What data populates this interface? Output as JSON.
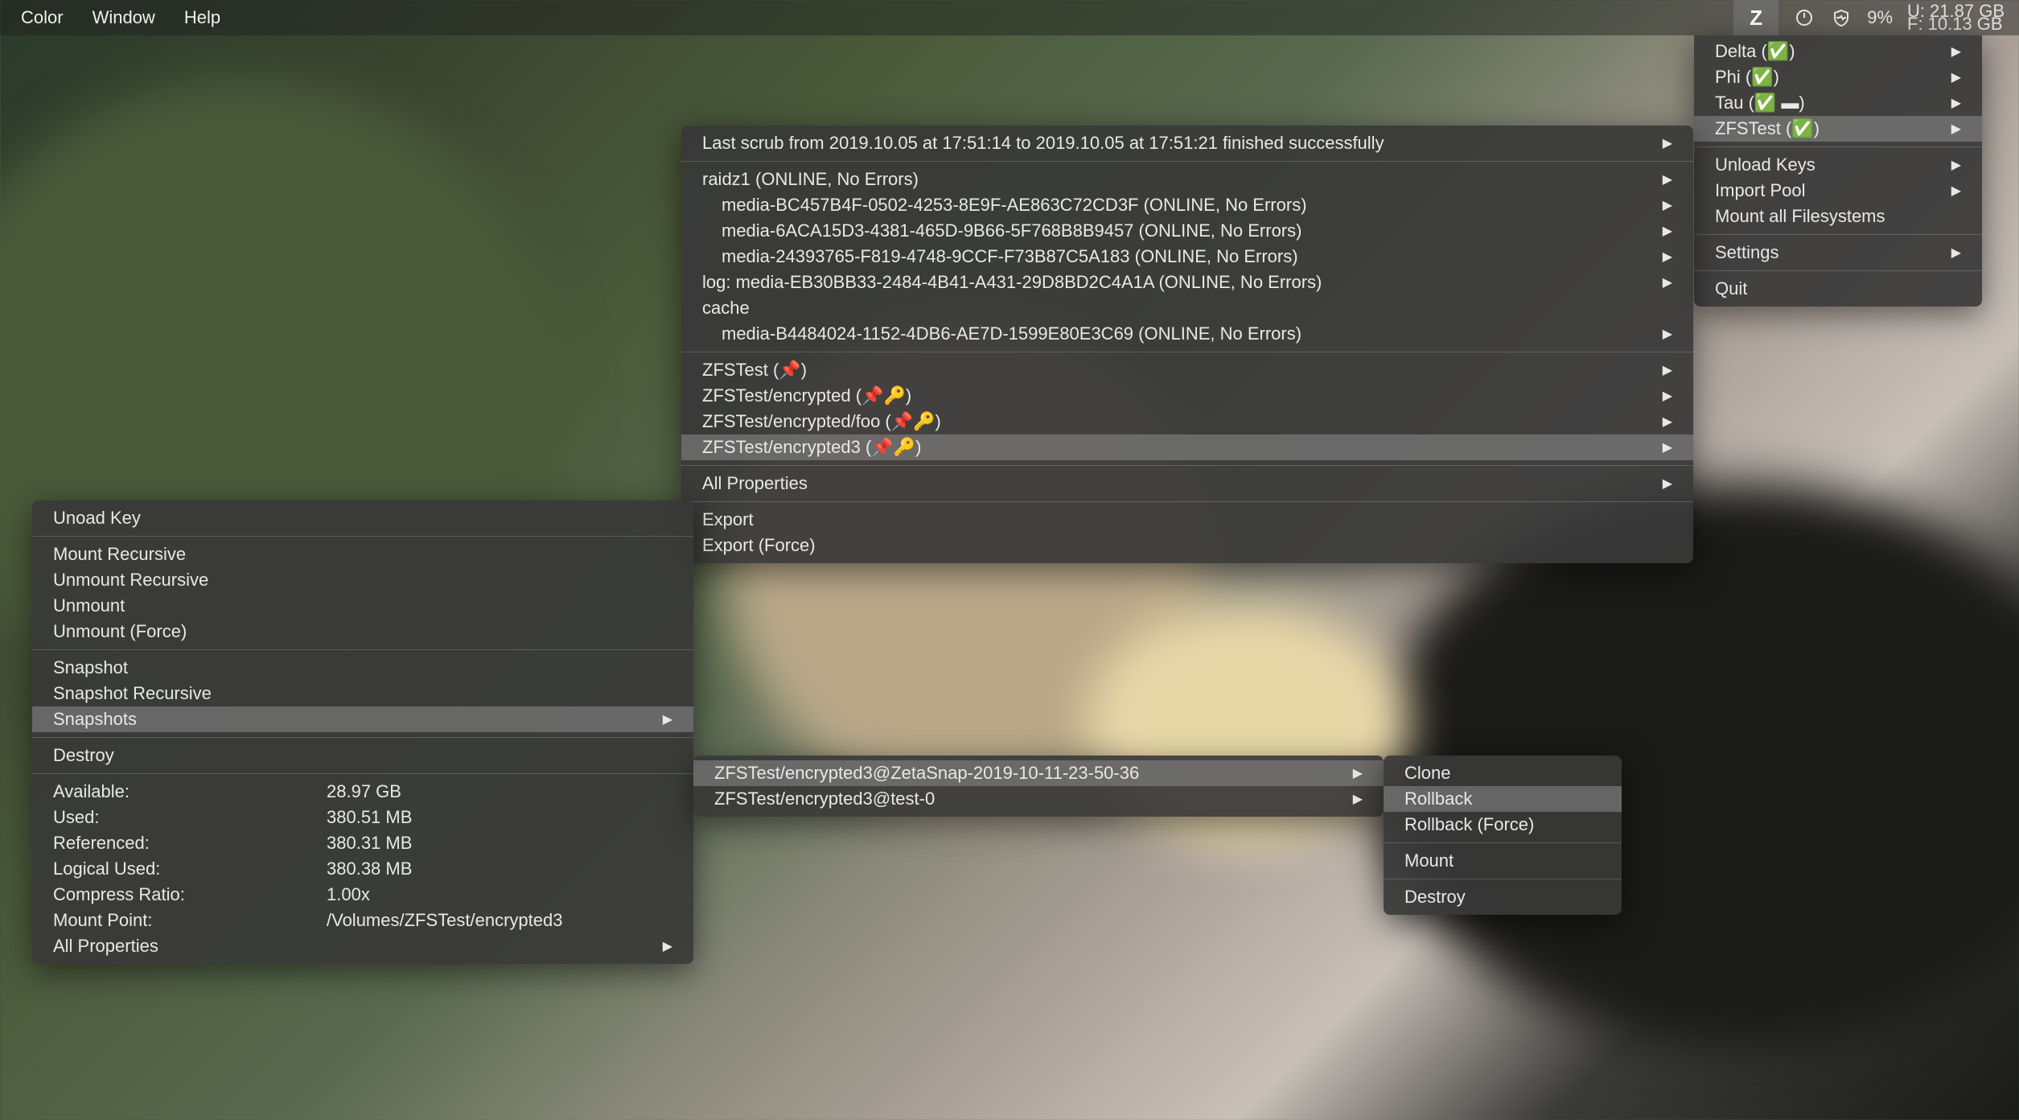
{
  "menubar": {
    "items": [
      "Color",
      "Window",
      "Help"
    ],
    "battery": "9%",
    "disk_used_label": "U:",
    "disk_used": "21.87 GB",
    "disk_free_label": "F:",
    "disk_free": "10.13 GB"
  },
  "pools": {
    "items": [
      {
        "label": "Delta (✅)"
      },
      {
        "label": "Phi (✅)"
      },
      {
        "label": "Tau (✅ ▬)"
      },
      {
        "label": "ZFSTest (✅)"
      }
    ],
    "unload_keys": "Unload Keys",
    "import_pool": "Import Pool",
    "mount_all": "Mount all Filesystems",
    "settings": "Settings",
    "quit": "Quit"
  },
  "pool_detail": {
    "scrub": "Last scrub from 2019.10.05 at 17:51:14 to 2019.10.05 at 17:51:21 finished successfully",
    "vdevs": [
      {
        "text": "raidz1 (ONLINE, No Errors)",
        "indent": 0
      },
      {
        "text": "media-BC457B4F-0502-4253-8E9F-AE863C72CD3F (ONLINE, No Errors)",
        "indent": 1
      },
      {
        "text": "media-6ACA15D3-4381-465D-9B66-5F768B8B9457 (ONLINE, No Errors)",
        "indent": 1
      },
      {
        "text": "media-24393765-F819-4748-9CCF-F73B87C5A183 (ONLINE, No Errors)",
        "indent": 1
      },
      {
        "text": "log: media-EB30BB33-2484-4B41-A431-29D8BD2C4A1A (ONLINE, No Errors)",
        "indent": 0
      },
      {
        "text": "cache",
        "indent": 0
      },
      {
        "text": "media-B4484024-1152-4DB6-AE7D-1599E80E3C69 (ONLINE, No Errors)",
        "indent": 1
      }
    ],
    "datasets": [
      {
        "label": "ZFSTest (📌)"
      },
      {
        "label": "ZFSTest/encrypted (📌🔑)"
      },
      {
        "label": "ZFSTest/encrypted/foo (📌🔑)"
      },
      {
        "label": "ZFSTest/encrypted3 (📌🔑)"
      }
    ],
    "all_properties": "All Properties",
    "export": "Export",
    "export_force": "Export (Force)"
  },
  "dataset_menu": {
    "unload_key": "Unoad Key",
    "mount_recursive": "Mount Recursive",
    "unmount_recursive": "Unmount Recursive",
    "unmount": "Unmount",
    "unmount_force": "Unmount (Force)",
    "snapshot": "Snapshot",
    "snapshot_recursive": "Snapshot Recursive",
    "snapshots": "Snapshots",
    "destroy": "Destroy",
    "props": [
      {
        "label": "Available:",
        "value": "28.97 GB"
      },
      {
        "label": "Used:",
        "value": "380.51 MB"
      },
      {
        "label": "Referenced:",
        "value": "380.31 MB"
      },
      {
        "label": "Logical Used:",
        "value": "380.38 MB"
      },
      {
        "label": "Compress Ratio:",
        "value": "1.00x"
      },
      {
        "label": "Mount Point:",
        "value": "/Volumes/ZFSTest/encrypted3"
      }
    ],
    "all_properties": "All Properties"
  },
  "snapshots": {
    "items": [
      "ZFSTest/encrypted3@ZetaSnap-2019-10-11-23-50-36",
      "ZFSTest/encrypted3@test-0"
    ]
  },
  "snapact": {
    "clone": "Clone",
    "rollback": "Rollback",
    "rollback_force": "Rollback (Force)",
    "mount": "Mount",
    "destroy": "Destroy"
  }
}
